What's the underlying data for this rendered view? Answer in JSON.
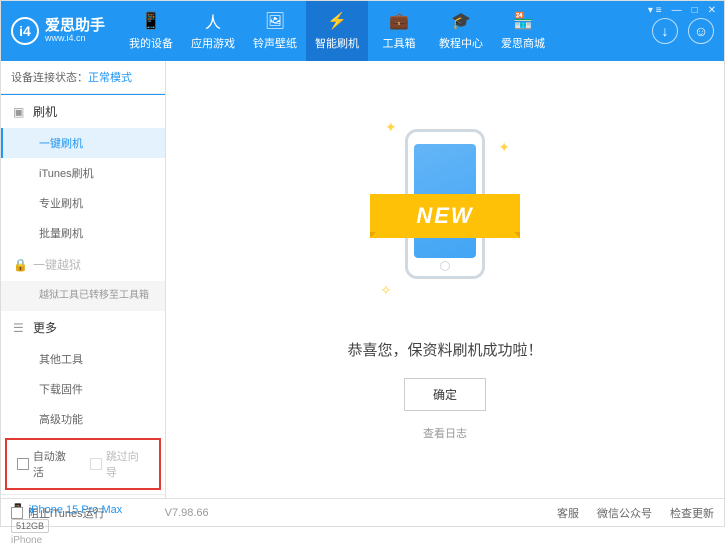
{
  "app": {
    "title": "爱思助手",
    "url": "www.i4.cn",
    "logo_letter": "i4"
  },
  "nav": [
    {
      "label": "我的设备",
      "icon": "📱"
    },
    {
      "label": "应用游戏",
      "icon": "人"
    },
    {
      "label": "铃声壁纸",
      "icon": "🖼"
    },
    {
      "label": "智能刷机",
      "icon": "⚡"
    },
    {
      "label": "工具箱",
      "icon": "💼"
    },
    {
      "label": "教程中心",
      "icon": "🎓"
    },
    {
      "label": "爱思商城",
      "icon": "🏪"
    }
  ],
  "connection": {
    "label": "设备连接状态：",
    "mode": "正常模式"
  },
  "sidebar": {
    "flash": {
      "title": "刷机",
      "items": [
        "一键刷机",
        "iTunes刷机",
        "专业刷机",
        "批量刷机"
      ]
    },
    "jailbreak": {
      "title": "一键越狱",
      "note": "越狱工具已转移至工具箱"
    },
    "more": {
      "title": "更多",
      "items": [
        "其他工具",
        "下载固件",
        "高级功能"
      ]
    }
  },
  "checkboxes": {
    "auto_activate": "自动激活",
    "skip_guide": "跳过向导"
  },
  "device": {
    "name": "iPhone 15 Pro Max",
    "storage": "512GB",
    "type": "iPhone"
  },
  "main": {
    "ribbon": "NEW",
    "success": "恭喜您，保资料刷机成功啦！",
    "ok": "确定",
    "log": "查看日志"
  },
  "footer": {
    "block_itunes": "阻止iTunes运行",
    "version": "V7.98.66",
    "links": [
      "客服",
      "微信公众号",
      "检查更新"
    ]
  }
}
